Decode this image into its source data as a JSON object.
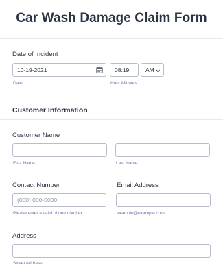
{
  "form": {
    "title": "Car Wash Damage Claim Form"
  },
  "incident": {
    "label": "Date of Incident",
    "date_value": "10-19-2021",
    "date_sublabel": "Date",
    "time_value": "08:19",
    "ampm_value": "AM",
    "time_sublabel": "Hour Minutes"
  },
  "customer_section": {
    "heading": "Customer Information"
  },
  "customer_name": {
    "label": "Customer Name",
    "first_sublabel": "First Name",
    "last_sublabel": "Last Name"
  },
  "contact": {
    "label": "Contact Number",
    "placeholder": "(000) 000-0000",
    "sublabel": "Please enter a valid phone number."
  },
  "email": {
    "label": "Email Address",
    "sublabel": "example@example.com"
  },
  "address": {
    "label": "Address",
    "street_sublabel": "Street Address"
  },
  "icons": {
    "date_picker": "calendar-icon",
    "dropdown": "chevron-down-icon"
  }
}
